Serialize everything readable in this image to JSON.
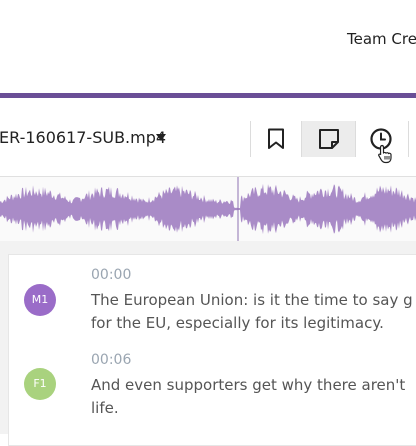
{
  "header": {
    "team_label": "Team Cre"
  },
  "colors": {
    "accent": "#6a4e96",
    "waveform": "#a98bc7",
    "speaker_m1": "#9a6cc8",
    "speaker_f1": "#a9d27e"
  },
  "toolbar": {
    "file_name": "ER-160617-SUB.mp4",
    "buttons": [
      {
        "icon": "bookmark-icon"
      },
      {
        "icon": "note-icon"
      },
      {
        "icon": "clock-icon"
      }
    ]
  },
  "transcript": {
    "utterances": [
      {
        "speaker": "M1",
        "time": "00:00",
        "lines": [
          "The European Union: is it the time to say g",
          "for the EU, especially for its legitimacy."
        ]
      },
      {
        "speaker": "F1",
        "time": "00:06",
        "lines": [
          "And even supporters get why there aren't",
          "life."
        ]
      }
    ]
  }
}
